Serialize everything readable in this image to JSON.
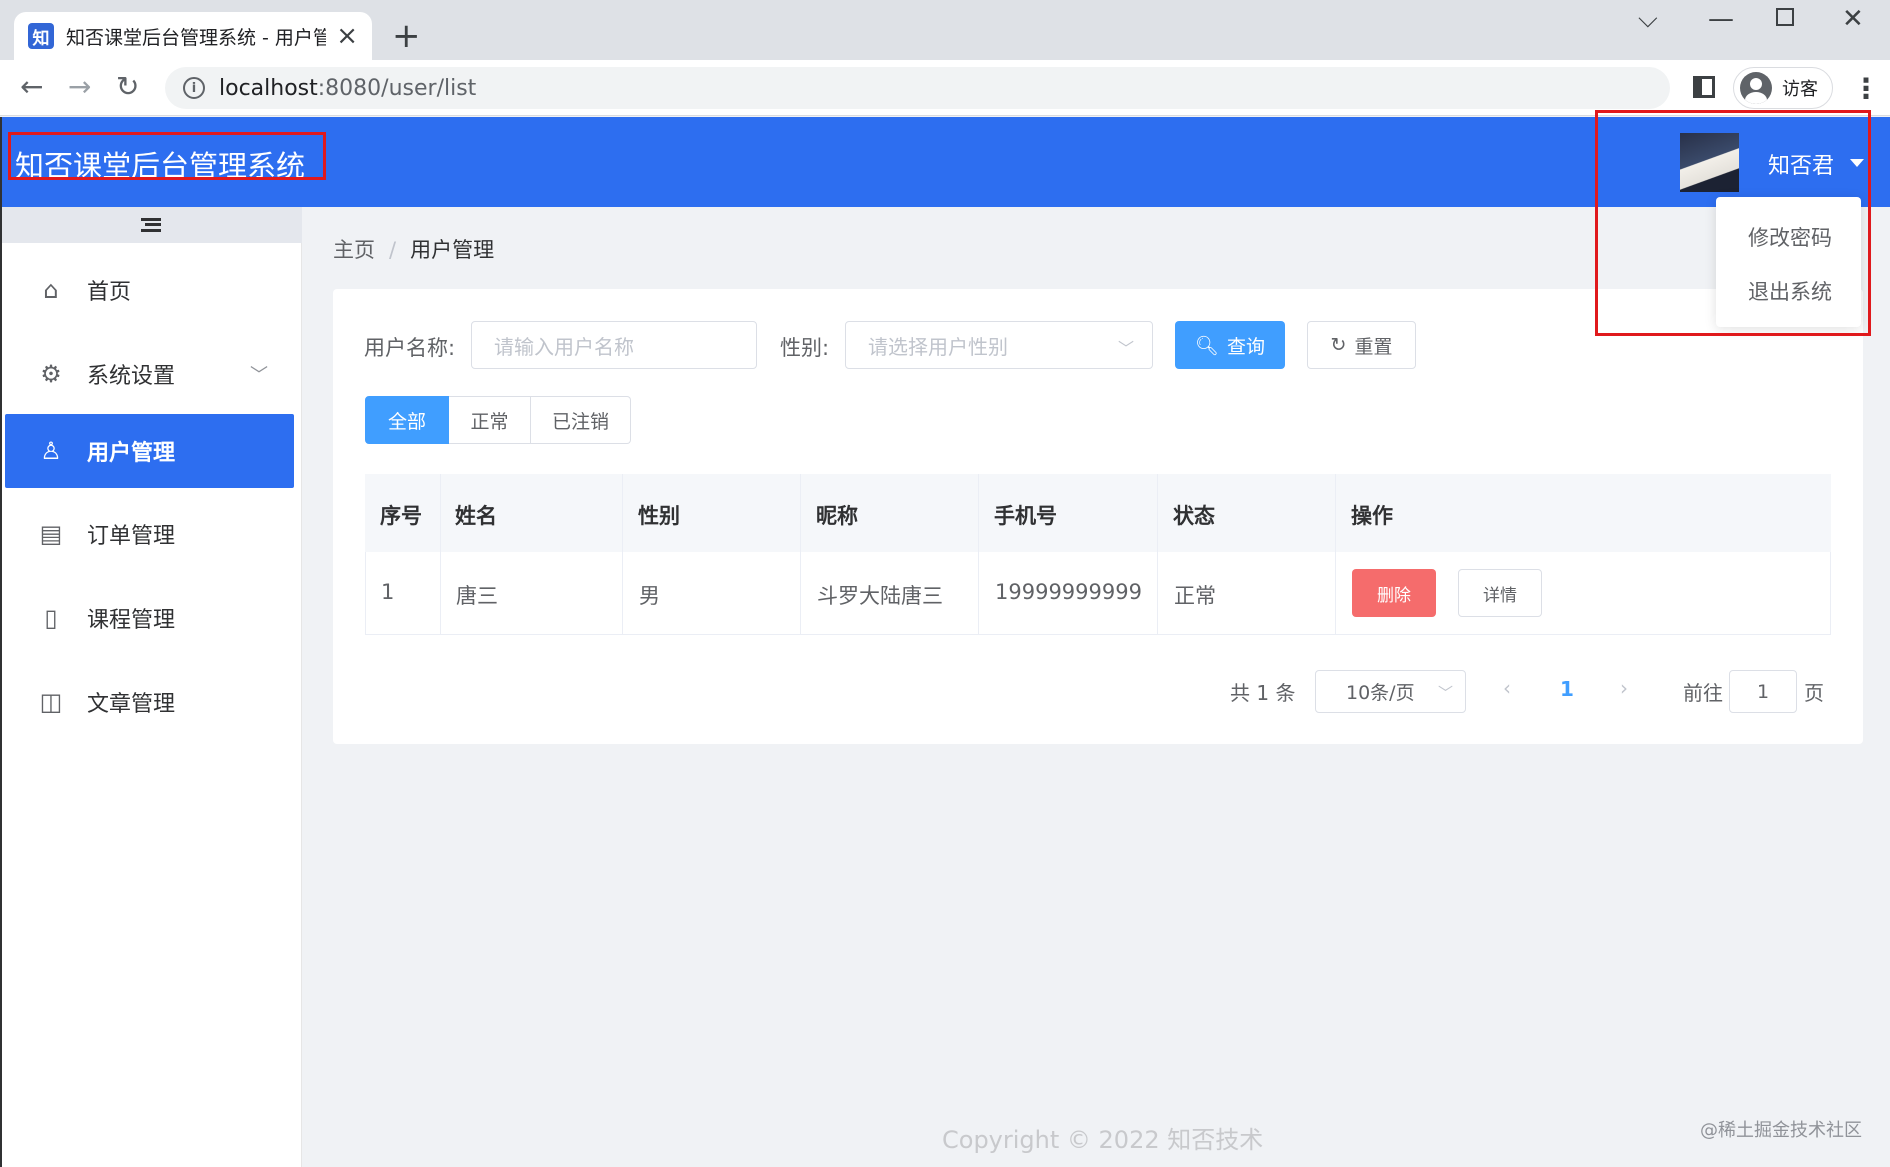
{
  "browser": {
    "tab_title": "知否课堂后台管理系统 - 用户管理",
    "favicon_text": "知",
    "url_host": "localhost",
    "url_rest": ":8080/user/list",
    "profile_label": "访客"
  },
  "header": {
    "app_title": "知否课堂后台管理系统",
    "user_name": "知否君",
    "brand_color": "#2d6ef0"
  },
  "user_menu": {
    "items": [
      "修改密码",
      "退出系统"
    ]
  },
  "sidebar": {
    "items": [
      {
        "label": "首页",
        "icon": "home-icon"
      },
      {
        "label": "系统设置",
        "icon": "gear-icon"
      },
      {
        "label": "用户管理",
        "icon": "user-icon",
        "active": true
      },
      {
        "label": "订单管理",
        "icon": "document-icon"
      },
      {
        "label": "课程管理",
        "icon": "notebook-icon"
      },
      {
        "label": "文章管理",
        "icon": "book-icon"
      }
    ]
  },
  "breadcrumb": {
    "home": "主页",
    "separator": "/",
    "current": "用户管理"
  },
  "search": {
    "name_label": "用户名称:",
    "name_placeholder": "请输入用户名称",
    "gender_label": "性别:",
    "gender_placeholder": "请选择用户性别",
    "query_button": "查询",
    "reset_button": "重置"
  },
  "filter_tabs": [
    "全部",
    "正常",
    "已注销"
  ],
  "table": {
    "columns": [
      "序号",
      "姓名",
      "性别",
      "昵称",
      "手机号",
      "状态",
      "操作"
    ],
    "rows": [
      {
        "index": "1",
        "name": "唐三",
        "gender": "男",
        "nickname": "斗罗大陆唐三",
        "phone": "19999999999",
        "status": "正常"
      }
    ],
    "delete_label": "删除",
    "detail_label": "详情"
  },
  "pagination": {
    "total": "共 1 条",
    "page_size": "10条/页",
    "current_page": "1",
    "goto_label": "前往",
    "goto_value": "1",
    "page_suffix": "页"
  },
  "footer": {
    "copyright": "Copyright © 2022 知否技术",
    "watermark": "@稀土掘金技术社区"
  }
}
